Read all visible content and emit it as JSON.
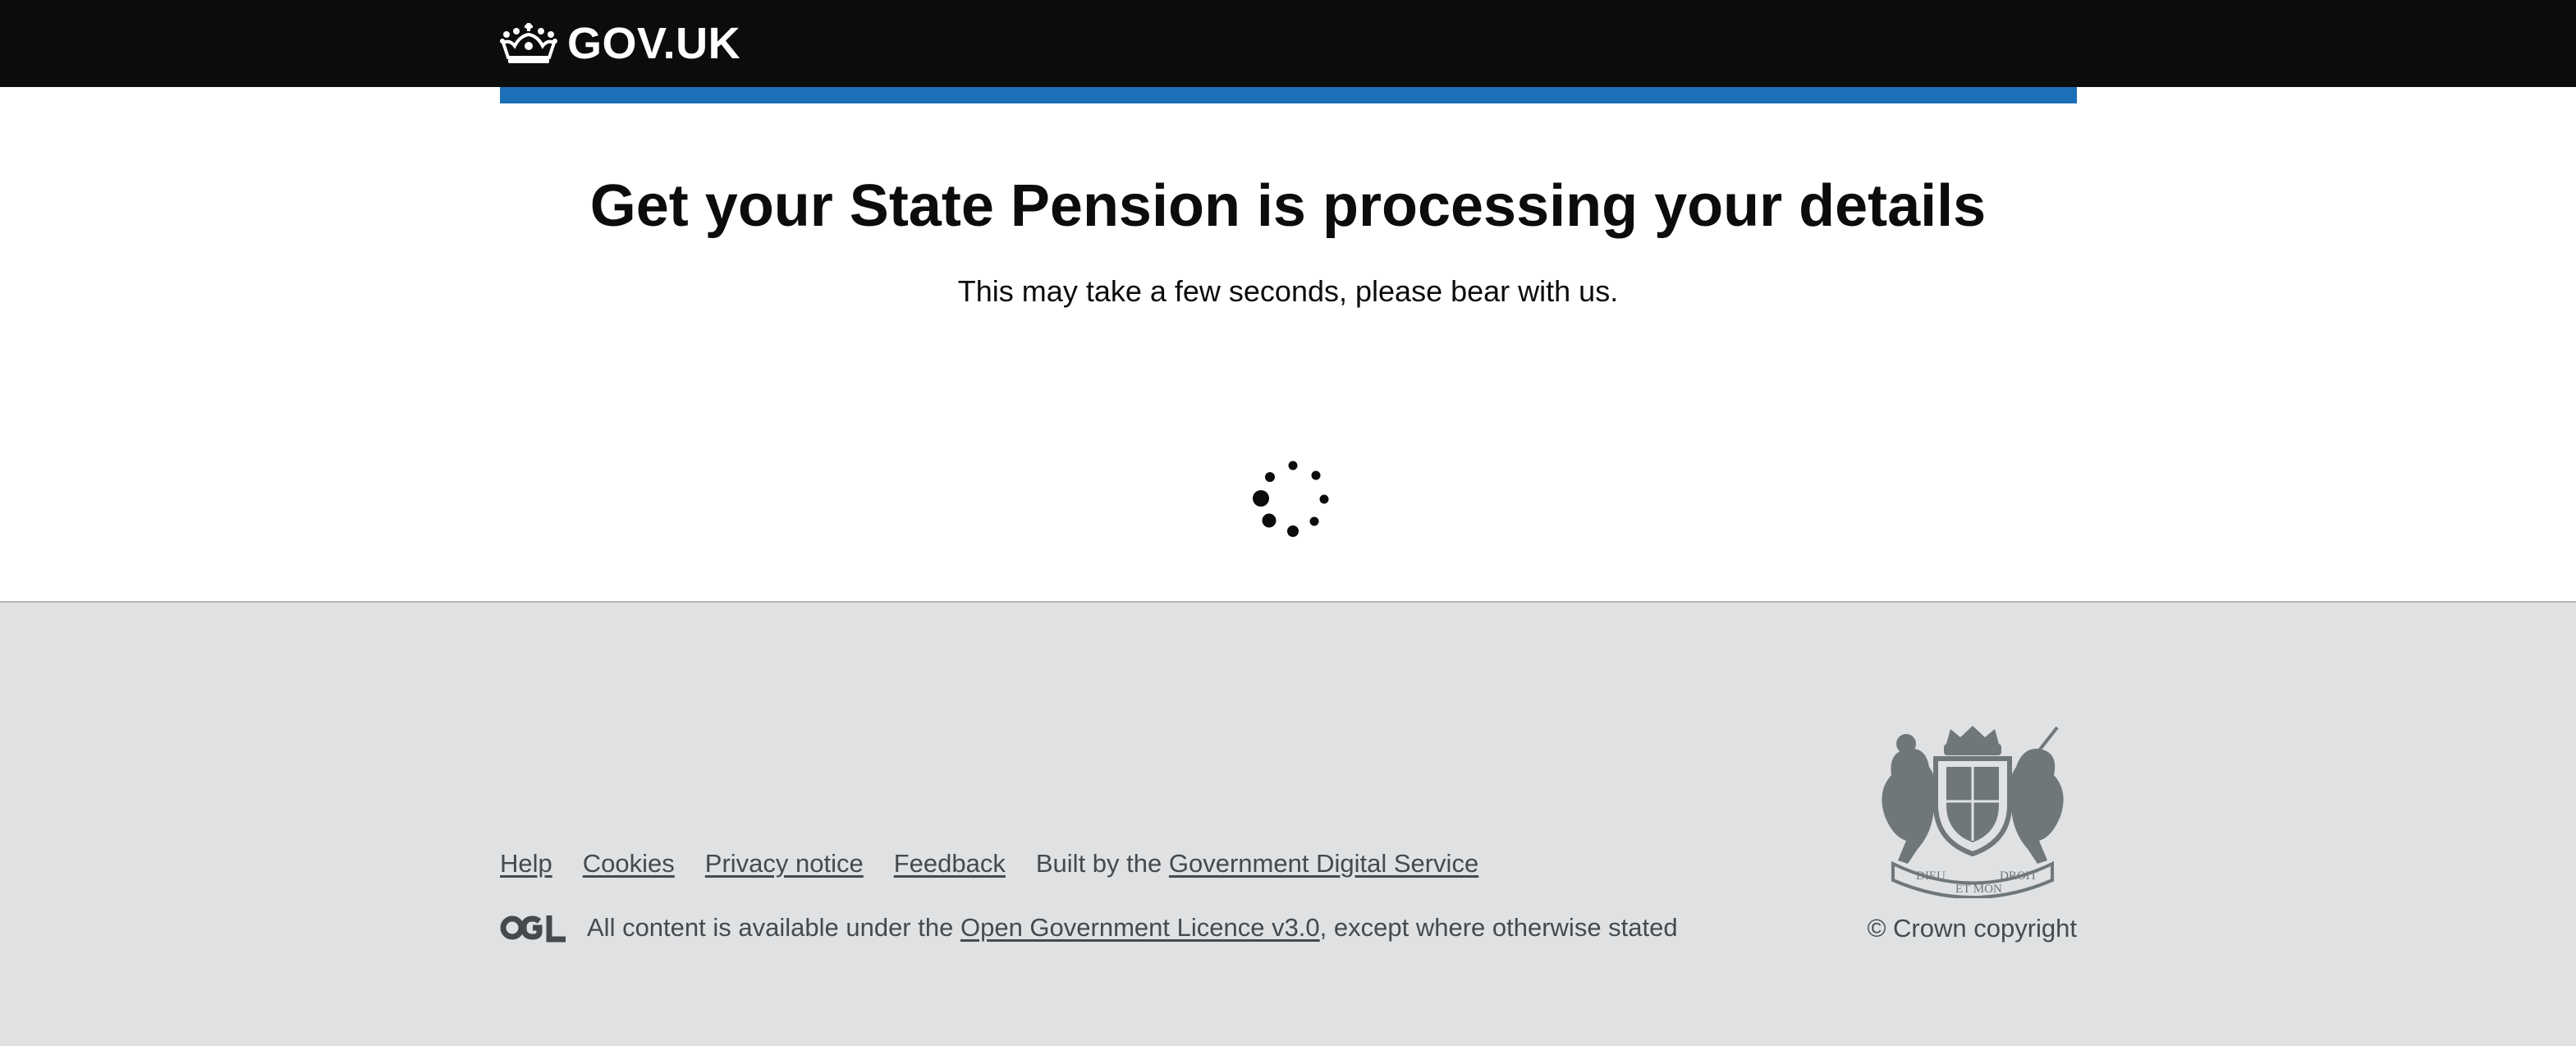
{
  "header": {
    "logo_text": "GOV.UK",
    "logo_icon": "crown-icon",
    "background_color": "#0b0c0c",
    "accent_bar_color": "#1d70b8"
  },
  "main": {
    "heading": "Get your State Pension is processing your details",
    "subtext": "This may take a few seconds, please bear with us.",
    "spinner_icon": "loading-spinner-icon"
  },
  "footer": {
    "background_color": "#dfe1e3",
    "links": [
      "Help",
      "Cookies",
      "Privacy notice",
      "Feedback"
    ],
    "built_by_prefix": "Built by the",
    "built_by_link": "Government Digital Service",
    "ogl_icon": "ogl-logo-icon",
    "licence_prefix": "All content is available under the",
    "licence_link": "Open Government Licence v3.0",
    "licence_suffix": ", except where otherwise stated",
    "crest_icon": "royal-coat-of-arms-icon",
    "crest_motto_left": "DIEU",
    "crest_motto_center": "ET MON",
    "crest_motto_right": "DROIT",
    "copyright": "© Crown copyright"
  }
}
